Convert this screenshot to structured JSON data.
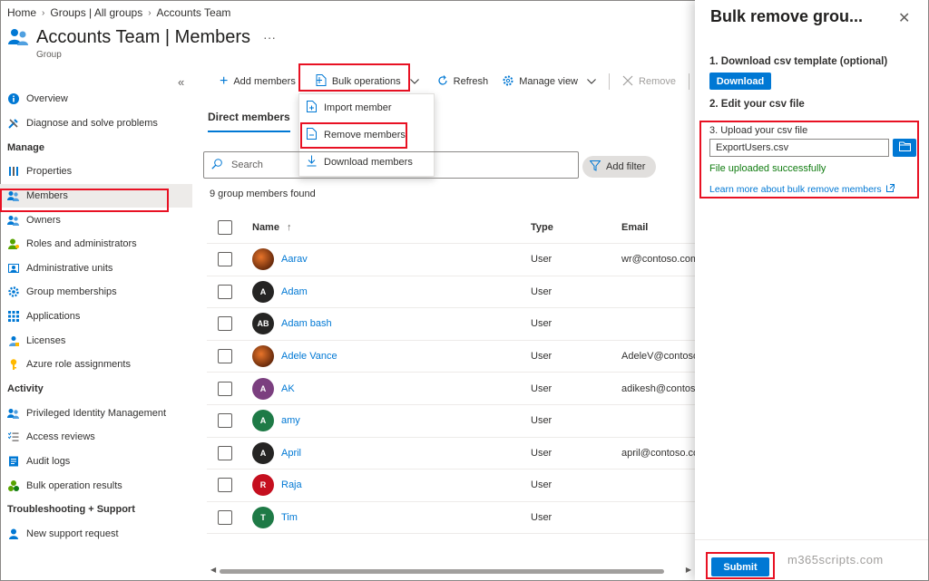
{
  "breadcrumb": [
    "Home",
    "Groups | All groups",
    "Accounts Team"
  ],
  "header": {
    "title": "Accounts Team | Members",
    "subtitle": "Group",
    "more": "···"
  },
  "nav": {
    "collapse": "«",
    "top": [
      {
        "label": "Overview",
        "icon": "info-icon"
      },
      {
        "label": "Diagnose and solve problems",
        "icon": "wrench-icon"
      }
    ],
    "manage_label": "Manage",
    "manage": [
      {
        "label": "Properties",
        "icon": "properties-icon"
      },
      {
        "label": "Members",
        "icon": "members-icon"
      },
      {
        "label": "Owners",
        "icon": "owners-icon"
      },
      {
        "label": "Roles and administrators",
        "icon": "roles-icon"
      },
      {
        "label": "Administrative units",
        "icon": "admin-units-icon"
      },
      {
        "label": "Group memberships",
        "icon": "gear-icon"
      },
      {
        "label": "Applications",
        "icon": "apps-grid-icon"
      },
      {
        "label": "Licenses",
        "icon": "licenses-icon"
      },
      {
        "label": "Azure role assignments",
        "icon": "key-icon"
      }
    ],
    "activity_label": "Activity",
    "activity": [
      {
        "label": "Privileged Identity Management",
        "icon": "pim-icon"
      },
      {
        "label": "Access reviews",
        "icon": "list-check-icon"
      },
      {
        "label": "Audit logs",
        "icon": "audit-log-icon"
      },
      {
        "label": "Bulk operation results",
        "icon": "bulk-results-icon"
      }
    ],
    "troubleshoot_label": "Troubleshooting + Support",
    "troubleshoot": [
      {
        "label": "New support request",
        "icon": "support-icon"
      }
    ]
  },
  "toolbar": {
    "add_members": "Add members",
    "bulk_operations": "Bulk operations",
    "refresh": "Refresh",
    "manage_view": "Manage view",
    "remove": "Remove"
  },
  "bulk_menu": [
    "Import member",
    "Remove members",
    "Download members"
  ],
  "tabs": {
    "direct_members": "Direct members"
  },
  "search": {
    "placeholder": "Search"
  },
  "add_filter": "Add filter",
  "found_text": "9 group members found",
  "table": {
    "headers": {
      "name": "Name",
      "type": "Type",
      "email": "Email",
      "sort": "↑"
    },
    "rows": [
      {
        "name": "Aarav",
        "type": "User",
        "email": "wr@contoso.com",
        "initials": "",
        "avatar_color": "photo"
      },
      {
        "name": "Adam",
        "type": "User",
        "email": "",
        "initials": "A",
        "avatar_color": "#252423"
      },
      {
        "name": "Adam bash",
        "type": "User",
        "email": "",
        "initials": "AB",
        "avatar_color": "#252423"
      },
      {
        "name": "Adele Vance",
        "type": "User",
        "email": "AdeleV@contoso.com",
        "initials": "",
        "avatar_color": "photo"
      },
      {
        "name": "AK",
        "type": "User",
        "email": "adikesh@contoso.com",
        "initials": "A",
        "avatar_color": "#7b3f7f"
      },
      {
        "name": "amy",
        "type": "User",
        "email": "",
        "initials": "A",
        "avatar_color": "#1e7a46"
      },
      {
        "name": "April",
        "type": "User",
        "email": "april@contoso.com",
        "initials": "A",
        "avatar_color": "#252423"
      },
      {
        "name": "Raja",
        "type": "User",
        "email": "",
        "initials": "R",
        "avatar_color": "#c50f1f"
      },
      {
        "name": "Tim",
        "type": "User",
        "email": "",
        "initials": "T",
        "avatar_color": "#1e7a46"
      }
    ]
  },
  "panel": {
    "title": "Bulk remove grou...",
    "close": "✕",
    "step1": "1. Download csv template (optional)",
    "download": "Download",
    "step2": "2. Edit your csv file",
    "step3": "3. Upload your csv file",
    "file_value": "ExportUsers.csv",
    "success": "File uploaded successfully",
    "learn_more": "Learn more about bulk remove members",
    "submit": "Submit"
  },
  "watermark": "m365scripts.com",
  "colors": {
    "accent": "#0078d4",
    "highlight": "#e81123",
    "success": "#107c10"
  }
}
